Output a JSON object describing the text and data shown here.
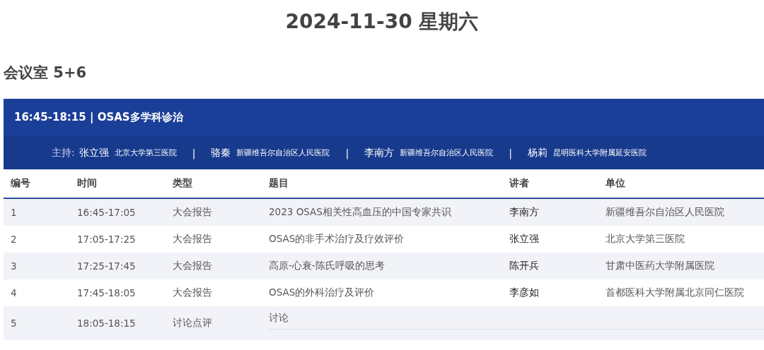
{
  "date_title": "2024-11-30 星期六",
  "room_title": "会议室 5+6",
  "session": {
    "title": "16:45-18:15 | OSAS多学科诊治",
    "host_label": "主持:",
    "hosts": [
      {
        "name": "张立强",
        "unit": "北京大学第三医院"
      },
      {
        "separator": "|",
        "name": "骆秦",
        "unit": "新疆维吾尔自治区人民医院"
      },
      {
        "separator": "|",
        "name": "李南方",
        "unit": "新疆维吾尔自治区人民医院"
      },
      {
        "separator": "|",
        "name": "杨莉",
        "unit": "昆明医科大学附属延安医院"
      }
    ]
  },
  "table": {
    "columns": [
      "编号",
      "时间",
      "类型",
      "题目",
      "讲者",
      "单位"
    ],
    "rows": [
      {
        "kind": "talk",
        "cells": [
          "1",
          "16:45-17:05",
          "大会报告",
          "2023 OSAS相关性高血压的中国专家共识",
          "李南方",
          "新疆维吾尔自治区人民医院"
        ]
      },
      {
        "kind": "talk",
        "cells": [
          "2",
          "17:05-17:25",
          "大会报告",
          "OSAS的非手术治疗及疗效评价",
          "张立强",
          "北京大学第三医院"
        ]
      },
      {
        "kind": "talk",
        "cells": [
          "3",
          "17:25-17:45",
          "大会报告",
          "高原-心衰-陈氏呼吸的思考",
          "陈开兵",
          "甘肃中医药大学附属医院"
        ]
      },
      {
        "kind": "talk",
        "cells": [
          "4",
          "17:45-18:05",
          "大会报告",
          "OSAS的外科治疗及评价",
          "李彦如",
          "首都医科大学附属北京同仁医院"
        ]
      },
      {
        "kind": "discussion",
        "cells": [
          "5",
          "18:05-18:15",
          "讨论点评",
          "讨论"
        ]
      }
    ]
  }
}
